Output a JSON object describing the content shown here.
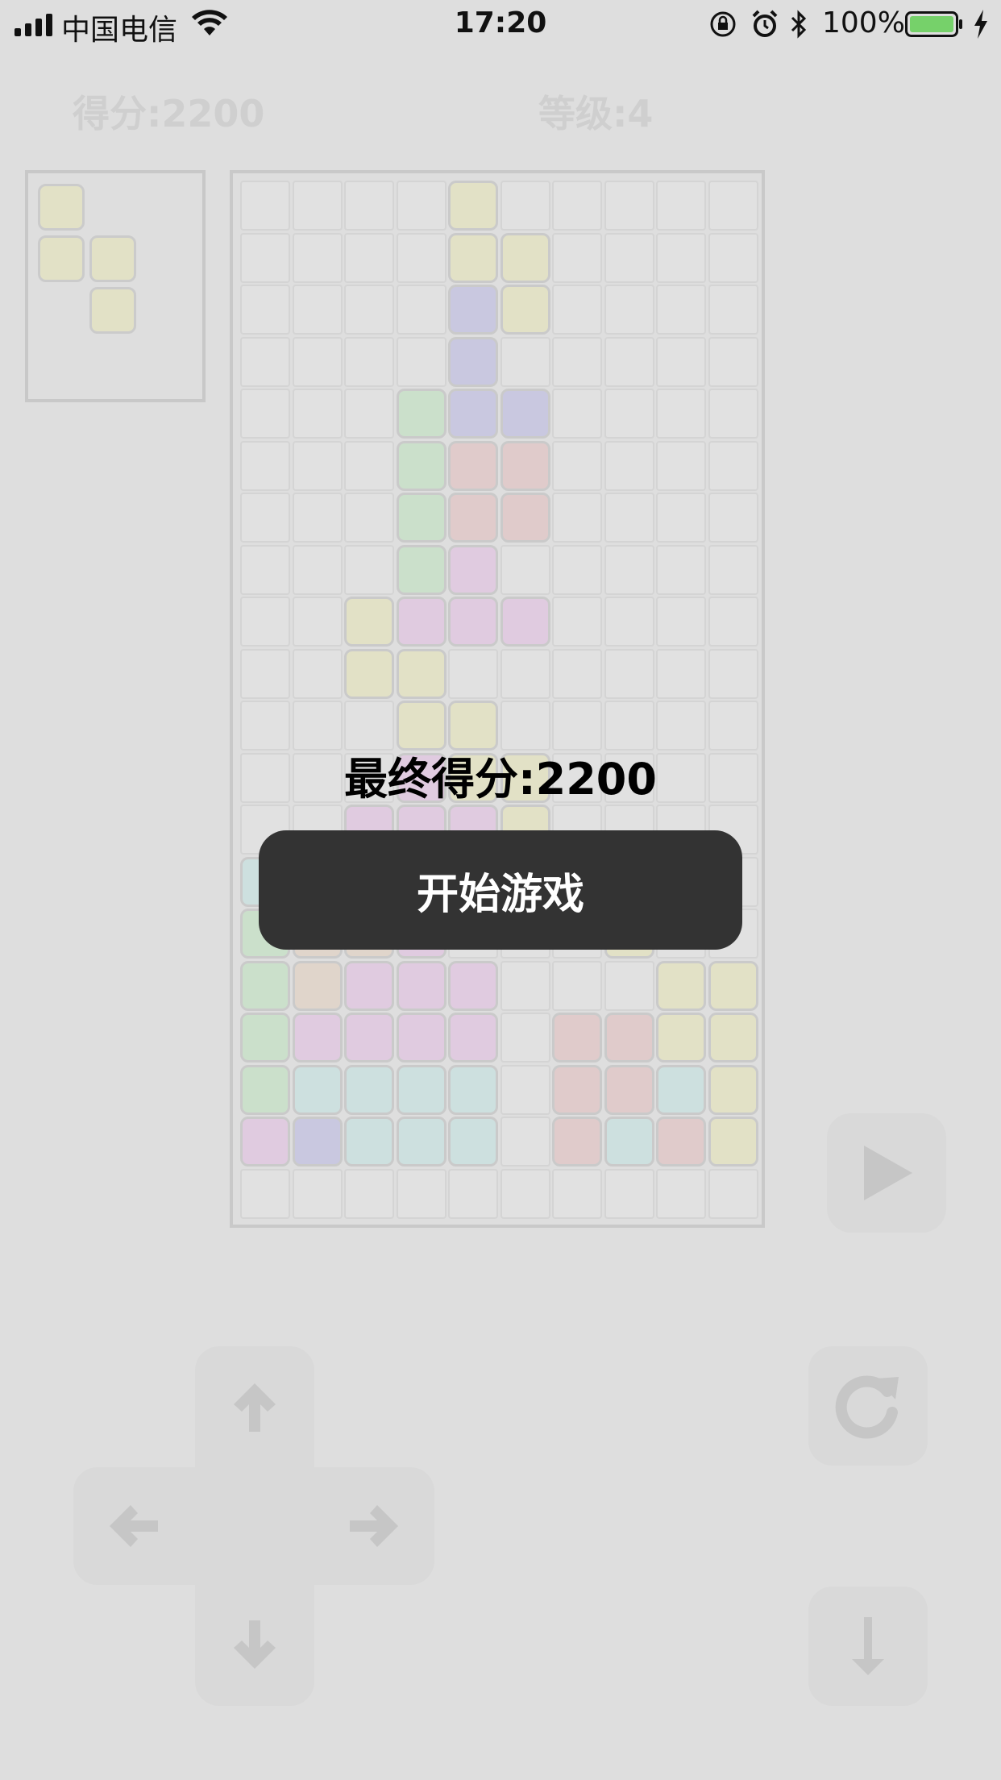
{
  "status_bar": {
    "carrier": "中国电信",
    "time": "17:20",
    "battery": "100%"
  },
  "header": {
    "score_label": "得分:2200",
    "level_label": "等级:4"
  },
  "game_over": {
    "final_score": "最终得分:2200",
    "start_button": "开始游戏"
  },
  "colors": {
    "Y": "#e2e1c6",
    "P": "#c9c8e0",
    "G": "#cbe0cb",
    "R": "#e0cbcb",
    "M": "#e0cbe0",
    "T": "#cde0df",
    "B": "#e0d5cb",
    "empty": "#e1e1e1"
  },
  "next_piece": {
    "color": "Y",
    "cells": [
      [
        0,
        0
      ],
      [
        1,
        0
      ],
      [
        1,
        1
      ],
      [
        2,
        1
      ]
    ]
  },
  "board": {
    "cols": 10,
    "rows": 20,
    "grid": [
      "....Y.....",
      "....YY....",
      "....PY....",
      "....P.....",
      "...GPP....",
      "...GRR....",
      "...GRR....",
      "...GM.....",
      "..YMMM....",
      "..YY......",
      "...YY.....",
      "...MYY....",
      "..MMMY....",
      "TPPP......",
      "GBBM...Y..",
      "GBMMM...YY",
      "GMMMM.RRYY",
      "GTTTT.RRTY",
      "MPTTT.RTRY",
      ".........."
    ]
  },
  "controls": {
    "play": "play-icon",
    "rotate": "rotate-icon",
    "drop": "drop-icon",
    "up": "arrow-up-icon",
    "down": "arrow-down-icon",
    "left": "arrow-left-icon",
    "right": "arrow-right-icon"
  }
}
